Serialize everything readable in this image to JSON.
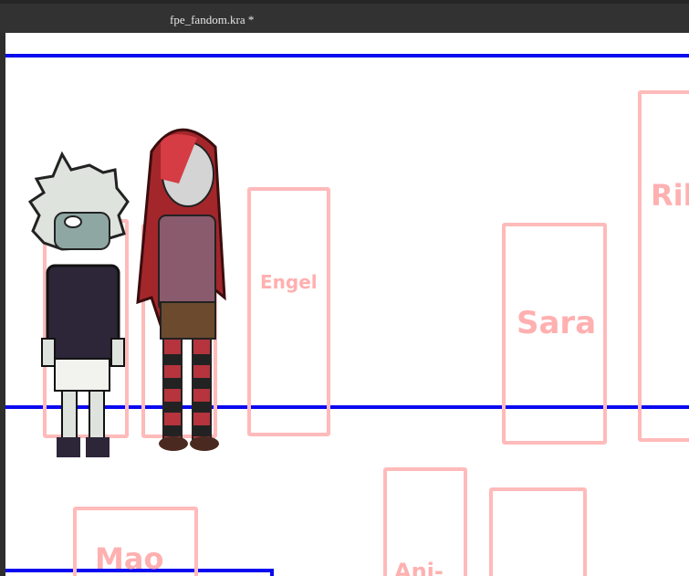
{
  "window": {
    "title": "fpe_fandom.kra *"
  },
  "canvas": {
    "guide_color": "#0a0af0",
    "box_color": "#ffbaba",
    "labels": {
      "engel": "Engel",
      "sara": "Sara",
      "ril": "Ril",
      "mao": "Mao",
      "ani": "Ani-"
    }
  }
}
